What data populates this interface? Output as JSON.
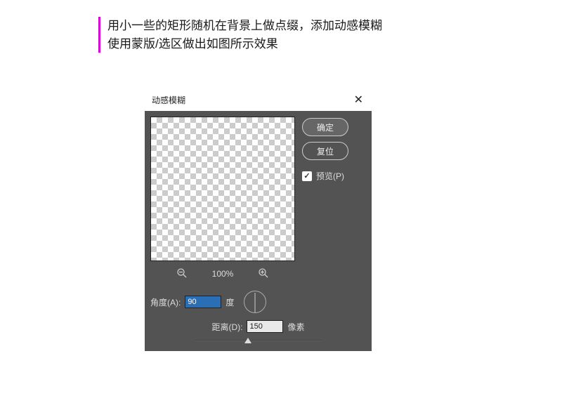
{
  "instruction": {
    "line1": "用小一些的矩形随机在背景上做点缀，添加动感模糊",
    "line2": "使用蒙版/选区做出如图所示效果"
  },
  "dialog": {
    "title": "动感模糊",
    "close": "✕",
    "ok": "确定",
    "reset": "复位",
    "preview_label": "预览(P)",
    "preview_checked": true,
    "zoom_out_icon": "zoom-out",
    "zoom_in_icon": "zoom-in",
    "zoom_pct": "100%",
    "angle": {
      "label": "角度(A):",
      "value": "90",
      "unit": "度"
    },
    "distance": {
      "label": "距离(D):",
      "value": "150",
      "unit": "像素"
    }
  }
}
